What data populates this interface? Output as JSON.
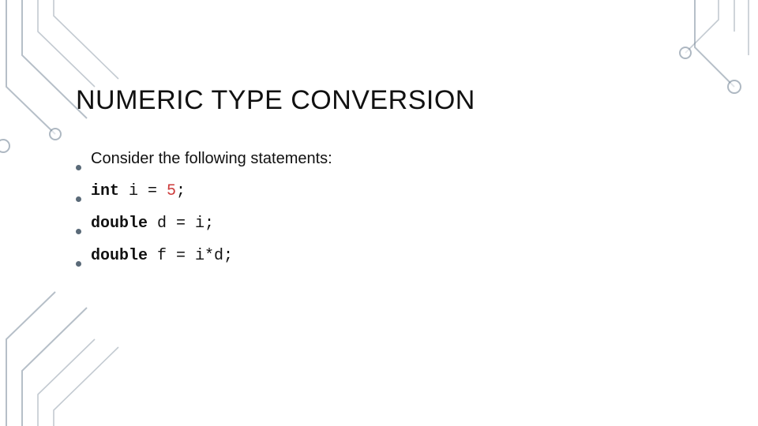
{
  "slide": {
    "title": "NUMERIC TYPE CONVERSION",
    "bullets": [
      {
        "type": "text",
        "text": "Consider the following statements:"
      },
      {
        "type": "code",
        "kw": "int",
        "rest_before": " i = ",
        "literal": "5",
        "rest_after": ";"
      },
      {
        "type": "code",
        "kw": "double",
        "rest_before": " d = i;",
        "literal": "",
        "rest_after": ""
      },
      {
        "type": "code",
        "kw": "double",
        "rest_before": " f = i*d;",
        "literal": "",
        "rest_after": ""
      }
    ]
  }
}
